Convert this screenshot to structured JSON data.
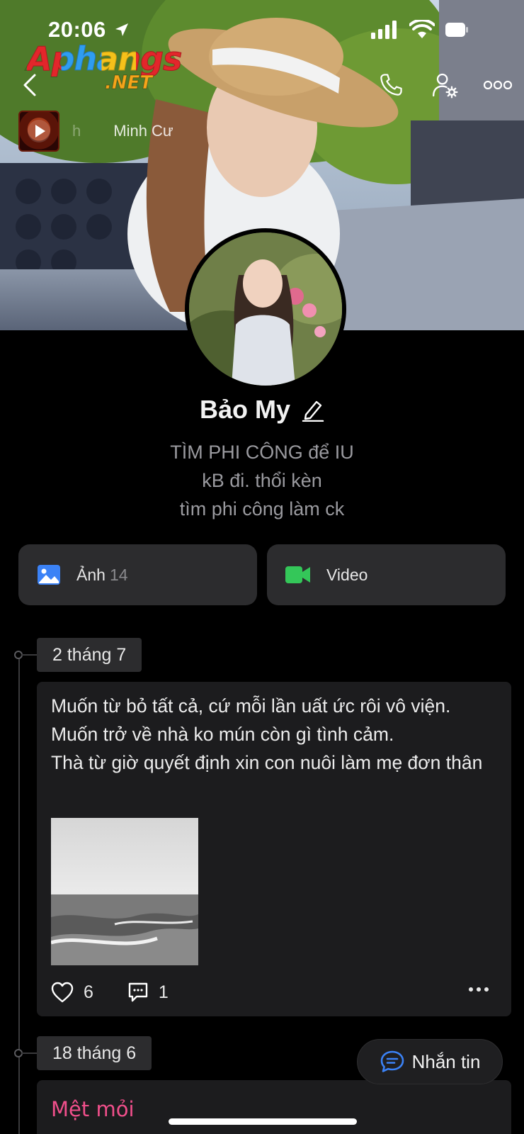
{
  "status_bar": {
    "time": "20:06"
  },
  "watermark": {
    "main": "Aphangs",
    "sub": ".NET"
  },
  "nav": {
    "back_icon": "chevron-left-icon",
    "call_icon": "phone-icon",
    "settings_icon": "user-gear-icon",
    "more_icon": "more-horizontal-icon"
  },
  "music": {
    "title_fade": "h",
    "title": "Minh Cư"
  },
  "profile": {
    "name": "Bảo My",
    "bio": [
      "TÌM PHI CÔNG để IU",
      "kB đi. thổi kèn",
      "tìm phi công làm ck"
    ]
  },
  "media": {
    "photos": {
      "label": "Ảnh",
      "count": "14",
      "color": "#3b82f6"
    },
    "video": {
      "label": "Video",
      "color": "#34c759"
    }
  },
  "timeline": [
    {
      "date": "2 tháng 7",
      "text": "Muốn từ bỏ tất cả, cứ mỗi lần uất ức rôi vô viện.\nMuốn trở về nhà ko mún còn gì tình cảm.\nThà từ giờ quyết định xin con nuôi làm mẹ đơn thân",
      "likes": "6",
      "comments": "1"
    },
    {
      "date": "18 tháng 6",
      "title": "Mệt mỏi"
    }
  ],
  "message_button": {
    "label": "Nhắn tin",
    "color": "#3b82f6"
  }
}
